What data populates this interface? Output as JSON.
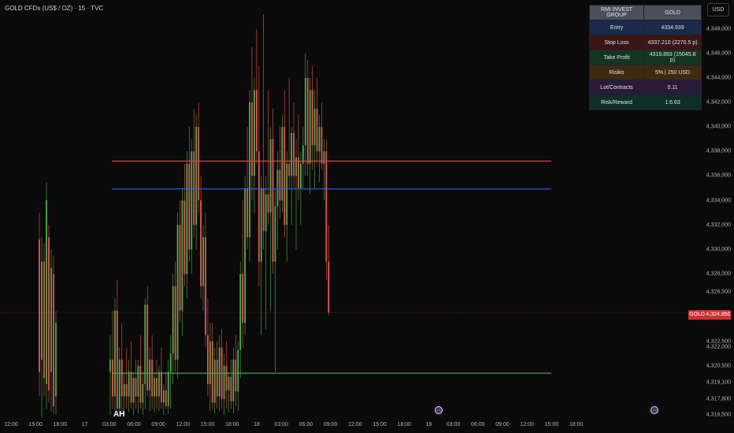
{
  "header": {
    "symbol_title": "GOLD CFDs (US$ / OZ) · 15 · TVC",
    "currency": "USD"
  },
  "info_table": {
    "rows": [
      {
        "label": "RMI INVEST GROUP",
        "value": "GOLD"
      },
      {
        "label": "Entry",
        "value": "4334.939"
      },
      {
        "label": "Stop Loss",
        "value": "4337.210 (2270.5 p)"
      },
      {
        "label": "Take Profit",
        "value": "4319.893 (15045.8 p)"
      },
      {
        "label": "Risiko",
        "value": "5% | 250 USD"
      },
      {
        "label": "Lot/Contracts",
        "value": "0.11"
      },
      {
        "label": "Risk/Reward",
        "value": "1:6.63"
      }
    ]
  },
  "price_tag": {
    "symbol": "GOLD",
    "value": "4,324.850"
  },
  "session_label": "AH",
  "colors": {
    "background": "#0a0a0a",
    "up": "#4caf50",
    "down": "#ef5350",
    "stop_loss": "#f23645",
    "entry": "#2962ff",
    "take_profit": "#4caf50",
    "current_price": "#d32f2f"
  },
  "chart_data": {
    "type": "candlestick",
    "y_ticks": [
      "4,348,000",
      "4,346,000",
      "4,344,000",
      "4,342,000",
      "4,340,000",
      "4,338,000",
      "4,336,000",
      "4,334,000",
      "4,332,000",
      "4,330,000",
      "4,328,000",
      "4,326,500",
      "4,322,500",
      "4,322,000",
      "4,320,500",
      "4,319,100",
      "4,317,800",
      "4,316,500"
    ],
    "y_tick_values": [
      4348.0,
      4346.0,
      4344.0,
      4342.0,
      4340.0,
      4338.0,
      4336.0,
      4334.0,
      4332.0,
      4330.0,
      4328.0,
      4326.5,
      4322.5,
      4322.0,
      4320.5,
      4319.1,
      4317.8,
      4316.5
    ],
    "x_ticks": [
      "12:00",
      "15:00",
      "18:00",
      "17",
      "03:00",
      "06:00",
      "09:00",
      "12:00",
      "15:00",
      "18:00",
      "18",
      "03:00",
      "06:00",
      "09:00",
      "12:00",
      "15:00",
      "18:00",
      "19",
      "03:00",
      "06:00",
      "09:00",
      "12:00",
      "15:00",
      "18:00"
    ],
    "levels": {
      "stop_loss": 4337.21,
      "entry": 4334.939,
      "take_profit": 4319.893,
      "current_price": 4324.85
    },
    "ylim": [
      4316.3,
      4349.2
    ],
    "candles": [
      [
        4330.8,
        4333.0,
        4318.0,
        4320.0
      ],
      [
        4321.0,
        4331.0,
        4316.3,
        4329.0
      ],
      [
        4329.0,
        4330.5,
        4318.0,
        4319.5
      ],
      [
        4319.0,
        4335.5,
        4317.0,
        4334.0
      ],
      [
        4331.0,
        4332.0,
        4317.5,
        4318.5
      ],
      [
        4320.0,
        4330.0,
        4316.8,
        4328.5
      ],
      [
        4328.0,
        4329.5,
        4316.6,
        4317.2
      ],
      [
        4318.0,
        4325.0,
        4316.5,
        4324.0
      ],
      [
        4320.0,
        4323.0,
        4316.5,
        4321.0
      ],
      [
        4321.0,
        4325.0,
        4317.0,
        4318.0
      ],
      [
        4318.0,
        4326.0,
        4316.8,
        4325.0
      ],
      [
        4325.0,
        4327.5,
        4316.5,
        4317.0
      ],
      [
        4317.0,
        4322.0,
        4316.5,
        4321.0
      ],
      [
        4321.0,
        4324.0,
        4316.6,
        4318.0
      ],
      [
        4318.0,
        4320.0,
        4316.5,
        4319.0
      ],
      [
        4319.0,
        4322.0,
        4317.0,
        4318.0
      ],
      [
        4318.0,
        4321.0,
        4316.7,
        4320.0
      ],
      [
        4320.0,
        4322.5,
        4317.0,
        4317.5
      ],
      [
        4317.5,
        4320.0,
        4316.5,
        4319.5
      ],
      [
        4319.5,
        4321.0,
        4317.0,
        4318.0
      ],
      [
        4318.0,
        4321.0,
        4316.6,
        4320.5
      ],
      [
        4320.5,
        4323.0,
        4317.0,
        4317.5
      ],
      [
        4317.5,
        4320.0,
        4316.5,
        4319.0
      ],
      [
        4319.0,
        4326.0,
        4317.0,
        4325.5
      ],
      [
        4325.5,
        4327.0,
        4318.0,
        4318.5
      ],
      [
        4318.5,
        4322.0,
        4316.8,
        4321.0
      ],
      [
        4321.0,
        4323.0,
        4317.0,
        4318.0
      ],
      [
        4318.0,
        4320.0,
        4316.7,
        4319.5
      ],
      [
        4319.5,
        4321.0,
        4317.0,
        4318.0
      ],
      [
        4318.0,
        4320.5,
        4316.8,
        4320.0
      ],
      [
        4320.0,
        4322.0,
        4317.0,
        4317.5
      ],
      [
        4317.5,
        4319.0,
        4316.5,
        4318.5
      ],
      [
        4318.5,
        4320.0,
        4317.0,
        4317.2
      ],
      [
        4317.2,
        4321.0,
        4316.6,
        4320.0
      ],
      [
        4320.0,
        4323.0,
        4317.0,
        4321.5
      ],
      [
        4321.5,
        4328.0,
        4319.0,
        4327.0
      ],
      [
        4327.0,
        4329.0,
        4320.0,
        4321.0
      ],
      [
        4321.0,
        4333.0,
        4319.5,
        4332.0
      ],
      [
        4332.0,
        4334.0,
        4324.0,
        4325.0
      ],
      [
        4325.0,
        4335.0,
        4323.0,
        4334.0
      ],
      [
        4334.0,
        4337.0,
        4327.0,
        4328.0
      ],
      [
        4328.0,
        4338.0,
        4326.0,
        4337.0
      ],
      [
        4337.0,
        4340.0,
        4329.0,
        4330.0
      ],
      [
        4330.0,
        4339.0,
        4328.0,
        4338.0
      ],
      [
        4338.0,
        4341.5,
        4331.0,
        4332.0
      ],
      [
        4332.0,
        4341.0,
        4330.0,
        4340.0
      ],
      [
        4340.0,
        4342.0,
        4333.0,
        4334.0
      ],
      [
        4334.0,
        4336.0,
        4326.0,
        4327.0
      ],
      [
        4327.0,
        4332.0,
        4325.0,
        4331.0
      ],
      [
        4331.0,
        4333.0,
        4322.0,
        4323.0
      ],
      [
        4323.0,
        4326.0,
        4318.0,
        4319.0
      ],
      [
        4319.0,
        4324.0,
        4316.8,
        4322.5
      ],
      [
        4322.5,
        4324.0,
        4317.0,
        4317.5
      ],
      [
        4317.5,
        4322.0,
        4316.6,
        4321.0
      ],
      [
        4321.0,
        4322.5,
        4317.0,
        4318.0
      ],
      [
        4318.0,
        4323.0,
        4316.8,
        4322.0
      ],
      [
        4322.0,
        4323.5,
        4317.0,
        4317.8
      ],
      [
        4317.8,
        4321.5,
        4316.5,
        4320.5
      ],
      [
        4320.5,
        4322.5,
        4317.0,
        4318.5
      ],
      [
        4318.5,
        4320.0,
        4316.7,
        4319.6
      ],
      [
        4319.6,
        4321.0,
        4317.0,
        4317.6
      ],
      [
        4317.6,
        4322.0,
        4316.6,
        4321.0
      ],
      [
        4321.0,
        4323.0,
        4317.2,
        4318.4
      ],
      [
        4318.4,
        4322.5,
        4316.8,
        4321.8
      ],
      [
        4321.8,
        4329.0,
        4319.5,
        4328.0
      ],
      [
        4328.0,
        4334.0,
        4322.0,
        4324.0
      ],
      [
        4324.0,
        4336.0,
        4323.0,
        4335.0
      ],
      [
        4335.0,
        4340.0,
        4330.0,
        4331.0
      ],
      [
        4331.0,
        4343.0,
        4329.0,
        4342.0
      ],
      [
        4342.0,
        4346.5,
        4334.0,
        4336.0
      ],
      [
        4336.0,
        4344.0,
        4333.0,
        4343.0
      ],
      [
        4343.0,
        4348.0,
        4337.0,
        4338.0
      ],
      [
        4338.0,
        4345.0,
        4327.0,
        4329.0
      ],
      [
        4329.0,
        4336.0,
        4323.0,
        4335.0
      ],
      [
        4335.0,
        4349.2,
        4330.0,
        4331.5
      ],
      [
        4331.5,
        4336.0,
        4323.5,
        4334.5
      ],
      [
        4334.5,
        4343.0,
        4332.0,
        4333.0
      ],
      [
        4333.0,
        4340.0,
        4325.0,
        4339.0
      ],
      [
        4339.0,
        4341.5,
        4328.0,
        4329.0
      ],
      [
        4329.0,
        4335.0,
        4320.0,
        4333.5
      ],
      [
        4333.5,
        4338.0,
        4330.0,
        4336.5
      ],
      [
        4336.5,
        4340.0,
        4332.5,
        4334.0
      ],
      [
        4334.0,
        4341.0,
        4333.0,
        4340.0
      ],
      [
        4340.0,
        4343.0,
        4331.0,
        4332.0
      ],
      [
        4332.0,
        4338.0,
        4329.0,
        4337.0
      ],
      [
        4337.0,
        4344.0,
        4335.0,
        4336.0
      ],
      [
        4336.0,
        4340.0,
        4332.0,
        4339.5
      ],
      [
        4339.5,
        4342.0,
        4335.0,
        4336.0
      ],
      [
        4336.0,
        4339.0,
        4330.0,
        4337.5
      ],
      [
        4337.5,
        4341.0,
        4334.0,
        4335.0
      ],
      [
        4335.0,
        4338.0,
        4332.0,
        4337.0
      ],
      [
        4337.0,
        4340.0,
        4335.0,
        4338.5
      ],
      [
        4338.5,
        4346.0,
        4336.0,
        4344.0
      ],
      [
        4344.0,
        4345.5,
        4336.0,
        4337.0
      ],
      [
        4337.0,
        4344.0,
        4334.5,
        4343.0
      ],
      [
        4343.0,
        4345.0,
        4336.5,
        4338.5
      ],
      [
        4338.5,
        4343.0,
        4335.0,
        4341.5
      ],
      [
        4341.5,
        4344.0,
        4337.0,
        4338.0
      ],
      [
        4338.0,
        4341.0,
        4335.5,
        4340.0
      ],
      [
        4340.0,
        4342.0,
        4336.5,
        4337.0
      ],
      [
        4337.0,
        4339.0,
        4334.0,
        4338.0
      ],
      [
        4338.0,
        4339.0,
        4327.5,
        4329.0
      ],
      [
        4329.0,
        4332.0,
        4324.6,
        4324.85
      ]
    ]
  }
}
